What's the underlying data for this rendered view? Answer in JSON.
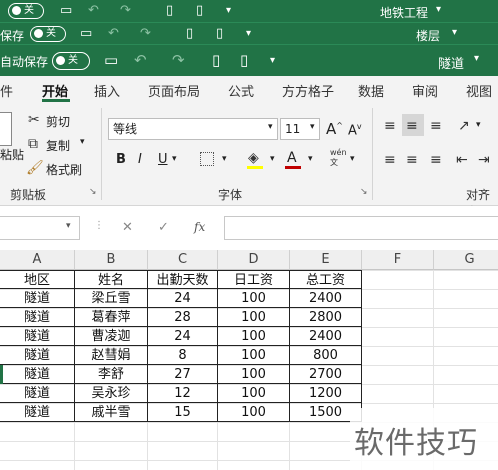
{
  "titlebars": {
    "bar1": {
      "toggle": "关",
      "doc_name": "地铁工程"
    },
    "bar2": {
      "left_label": "保存",
      "toggle": "关",
      "doc_name": "楼层"
    },
    "bar3": {
      "autosave_label": "自动保存",
      "toggle": "关",
      "doc_name": "隧道"
    }
  },
  "tabs": [
    "件",
    "开始",
    "插入",
    "页面布局",
    "公式",
    "方方格子",
    "数据",
    "审阅",
    "视图"
  ],
  "active_tab": "开始",
  "clipboard": {
    "paste": "粘贴",
    "cut": "剪切",
    "copy": "复制",
    "format_painter": "格式刷",
    "group_label": "剪贴板"
  },
  "font": {
    "name": "等线",
    "size": "11",
    "bold": "B",
    "italic": "I",
    "underline": "U",
    "group_label": "字体",
    "grow": "A",
    "shrink": "A",
    "font_color_letter": "A",
    "phonetic": "wén\n文"
  },
  "alignment": {
    "group_label": "对齐方"
  },
  "formula_bar": {
    "fx": "fx",
    "cancel": "✕",
    "enter": "✓"
  },
  "columns": [
    "A",
    "B",
    "C",
    "D",
    "E",
    "F",
    "G"
  ],
  "table": {
    "headers": [
      "地区",
      "姓名",
      "出勤天数",
      "日工资",
      "总工资"
    ],
    "rows": [
      [
        "隧道",
        "梁丘雪",
        "24",
        "100",
        "2400"
      ],
      [
        "隧道",
        "葛春萍",
        "28",
        "100",
        "2800"
      ],
      [
        "隧道",
        "曹凌迦",
        "24",
        "100",
        "2400"
      ],
      [
        "隧道",
        "赵彗娟",
        "8",
        "100",
        "800"
      ],
      [
        "隧道",
        "李舒",
        "27",
        "100",
        "2700"
      ],
      [
        "隧道",
        "吴永珍",
        "12",
        "100",
        "1200"
      ],
      [
        "隧道",
        "戚半雪",
        "15",
        "100",
        "1500"
      ]
    ]
  },
  "watermark": "软件技巧",
  "colors": {
    "accent": "#217346",
    "font_color": "#c00000",
    "highlight": "#ffff00"
  }
}
